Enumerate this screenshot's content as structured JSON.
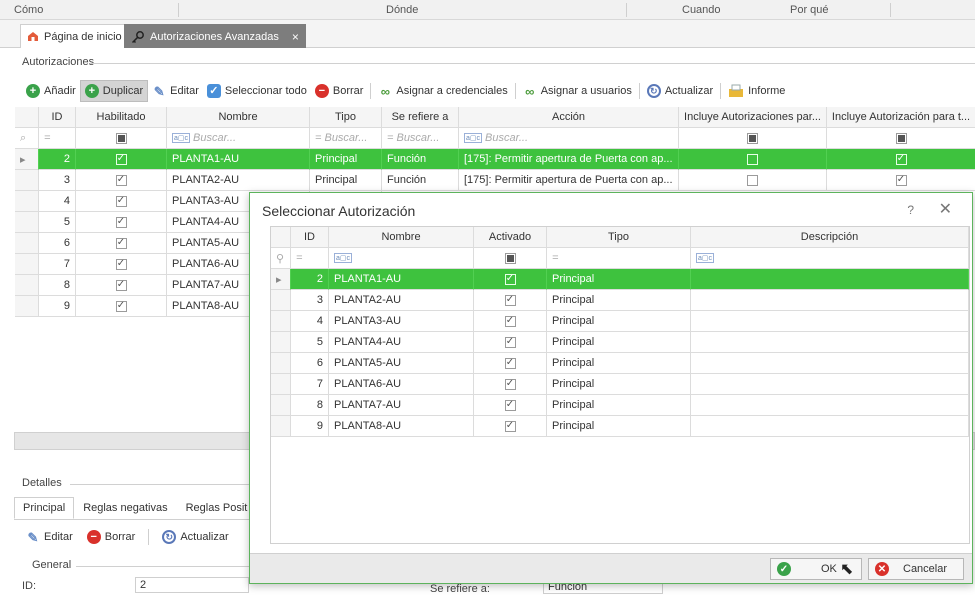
{
  "column_header": {
    "como": "Cómo",
    "donde": "Dónde",
    "cuando": "Cuando",
    "porque": "Por qué"
  },
  "tabs": [
    {
      "label": "Página de inicio",
      "icon": "home-icon"
    },
    {
      "label": "Autorizaciones Avanzadas",
      "icon": "key-icon",
      "close": "×"
    }
  ],
  "section_title": "Autorizaciones",
  "toolbar": {
    "add": "Añadir",
    "duplicate": "Duplicar",
    "edit": "Editar",
    "select_all": "Seleccionar todo",
    "delete": "Borrar",
    "assign_credentials": "Asignar a credenciales",
    "assign_users": "Asignar a usuarios",
    "refresh": "Actualizar",
    "report": "Informe"
  },
  "grid": {
    "headers": {
      "id": "ID",
      "enabled": "Habilitado",
      "name": "Nombre",
      "type": "Tipo",
      "refers": "Se refiere a",
      "action": "Acción",
      "incl1": "Incluye Autorizaciones par...",
      "incl2": "Incluye Autorización para t..."
    },
    "filter": {
      "eq": "=",
      "search": "Buscar...",
      "eq_search": "= Buscar..."
    },
    "rows": [
      {
        "id": "2",
        "name": "PLANTA1-AU",
        "type": "Principal",
        "refers": "Función",
        "action": "[175]: Permitir apertura de Puerta con ap...",
        "enabled": true,
        "incl1": false,
        "incl2": true
      },
      {
        "id": "3",
        "name": "PLANTA2-AU",
        "type": "Principal",
        "refers": "Función",
        "action": "[175]: Permitir apertura de Puerta con ap...",
        "enabled": true,
        "incl1": false,
        "incl2": true
      },
      {
        "id": "4",
        "name": "PLANTA3-AU",
        "enabled": true
      },
      {
        "id": "5",
        "name": "PLANTA4-AU",
        "enabled": true
      },
      {
        "id": "6",
        "name": "PLANTA5-AU",
        "enabled": true
      },
      {
        "id": "7",
        "name": "PLANTA6-AU",
        "enabled": true
      },
      {
        "id": "8",
        "name": "PLANTA7-AU",
        "enabled": true
      },
      {
        "id": "9",
        "name": "PLANTA8-AU",
        "enabled": true
      }
    ]
  },
  "details": {
    "title": "Detalles",
    "tabs": [
      "Principal",
      "Reglas negativas",
      "Reglas Posit"
    ],
    "edit": "Editar",
    "delete": "Borrar",
    "refresh": "Actualizar",
    "general": "General",
    "id_label": "ID:",
    "id_value": "2",
    "refers_label": "Se refiere a:",
    "refers_value": "Función"
  },
  "dialog": {
    "title": "Seleccionar Autorización",
    "help": "?",
    "close": "✕",
    "headers": {
      "id": "ID",
      "name": "Nombre",
      "active": "Activado",
      "type": "Tipo",
      "desc": "Descripción"
    },
    "filter_eq": "=",
    "rows": [
      {
        "id": "2",
        "name": "PLANTA1-AU",
        "type": "Principal"
      },
      {
        "id": "3",
        "name": "PLANTA2-AU",
        "type": "Principal"
      },
      {
        "id": "4",
        "name": "PLANTA3-AU",
        "type": "Principal"
      },
      {
        "id": "5",
        "name": "PLANTA4-AU",
        "type": "Principal"
      },
      {
        "id": "6",
        "name": "PLANTA5-AU",
        "type": "Principal"
      },
      {
        "id": "7",
        "name": "PLANTA6-AU",
        "type": "Principal"
      },
      {
        "id": "8",
        "name": "PLANTA7-AU",
        "type": "Principal"
      },
      {
        "id": "9",
        "name": "PLANTA8-AU",
        "type": "Principal"
      }
    ],
    "ok": "OK",
    "cancel": "Cancelar"
  },
  "colors": {
    "selection": "#3ec23e",
    "dialog_border": "#5cb35c",
    "tab_active": "#7d7d7d"
  }
}
